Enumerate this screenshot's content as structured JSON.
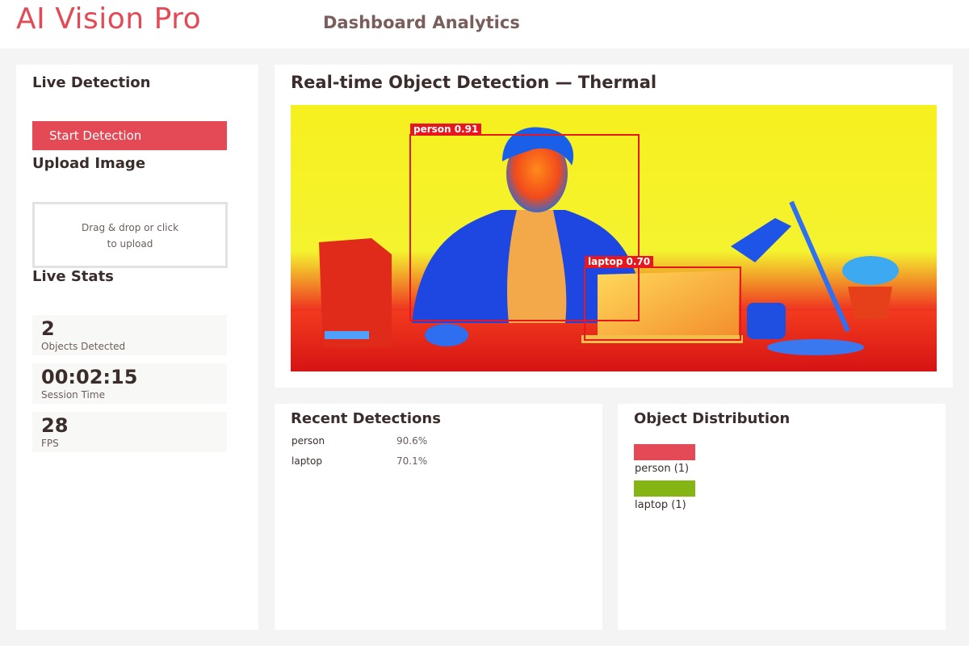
{
  "header": {
    "brand": "AI Vision Pro",
    "subtitle": "Dashboard Analytics"
  },
  "sidebar": {
    "live_detection_title": "Live Detection",
    "start_button_label": "Start Detection",
    "upload_title": "Upload Image",
    "upload_line1": "Drag & drop or click",
    "upload_line2": "to upload",
    "live_stats_title": "Live Stats",
    "stats": [
      {
        "value": "2",
        "label": "Objects Detected"
      },
      {
        "value": "00:02:15",
        "label": "Session Time"
      },
      {
        "value": "28",
        "label": "FPS"
      }
    ]
  },
  "video": {
    "title": "Real-time Object Detection — Thermal",
    "detections": [
      {
        "label": "person 0.91"
      },
      {
        "label": "laptop 0.70"
      }
    ]
  },
  "recent": {
    "title": "Recent Detections",
    "items": [
      {
        "name": "person",
        "confidence": "90.6%"
      },
      {
        "name": "laptop",
        "confidence": "70.1%"
      }
    ]
  },
  "distribution": {
    "title": "Object Distribution",
    "items": [
      {
        "label": "person (1)",
        "color": "#e34a56"
      },
      {
        "label": "laptop (1)",
        "color": "#84b515"
      }
    ]
  }
}
